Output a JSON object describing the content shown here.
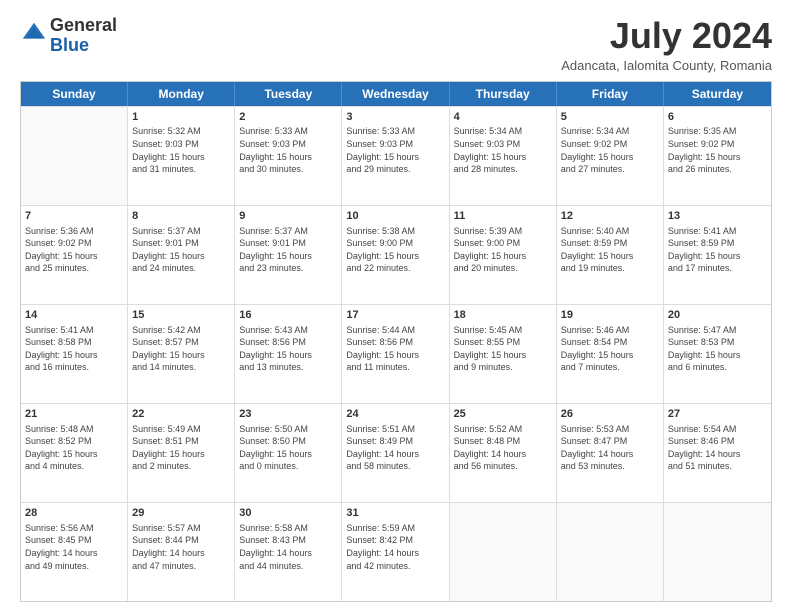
{
  "header": {
    "logo_general": "General",
    "logo_blue": "Blue",
    "month_title": "July 2024",
    "location": "Adancata, Ialomita County, Romania"
  },
  "weekdays": [
    "Sunday",
    "Monday",
    "Tuesday",
    "Wednesday",
    "Thursday",
    "Friday",
    "Saturday"
  ],
  "rows": [
    [
      {
        "day": "",
        "info": ""
      },
      {
        "day": "1",
        "info": "Sunrise: 5:32 AM\nSunset: 9:03 PM\nDaylight: 15 hours\nand 31 minutes."
      },
      {
        "day": "2",
        "info": "Sunrise: 5:33 AM\nSunset: 9:03 PM\nDaylight: 15 hours\nand 30 minutes."
      },
      {
        "day": "3",
        "info": "Sunrise: 5:33 AM\nSunset: 9:03 PM\nDaylight: 15 hours\nand 29 minutes."
      },
      {
        "day": "4",
        "info": "Sunrise: 5:34 AM\nSunset: 9:03 PM\nDaylight: 15 hours\nand 28 minutes."
      },
      {
        "day": "5",
        "info": "Sunrise: 5:34 AM\nSunset: 9:02 PM\nDaylight: 15 hours\nand 27 minutes."
      },
      {
        "day": "6",
        "info": "Sunrise: 5:35 AM\nSunset: 9:02 PM\nDaylight: 15 hours\nand 26 minutes."
      }
    ],
    [
      {
        "day": "7",
        "info": "Sunrise: 5:36 AM\nSunset: 9:02 PM\nDaylight: 15 hours\nand 25 minutes."
      },
      {
        "day": "8",
        "info": "Sunrise: 5:37 AM\nSunset: 9:01 PM\nDaylight: 15 hours\nand 24 minutes."
      },
      {
        "day": "9",
        "info": "Sunrise: 5:37 AM\nSunset: 9:01 PM\nDaylight: 15 hours\nand 23 minutes."
      },
      {
        "day": "10",
        "info": "Sunrise: 5:38 AM\nSunset: 9:00 PM\nDaylight: 15 hours\nand 22 minutes."
      },
      {
        "day": "11",
        "info": "Sunrise: 5:39 AM\nSunset: 9:00 PM\nDaylight: 15 hours\nand 20 minutes."
      },
      {
        "day": "12",
        "info": "Sunrise: 5:40 AM\nSunset: 8:59 PM\nDaylight: 15 hours\nand 19 minutes."
      },
      {
        "day": "13",
        "info": "Sunrise: 5:41 AM\nSunset: 8:59 PM\nDaylight: 15 hours\nand 17 minutes."
      }
    ],
    [
      {
        "day": "14",
        "info": "Sunrise: 5:41 AM\nSunset: 8:58 PM\nDaylight: 15 hours\nand 16 minutes."
      },
      {
        "day": "15",
        "info": "Sunrise: 5:42 AM\nSunset: 8:57 PM\nDaylight: 15 hours\nand 14 minutes."
      },
      {
        "day": "16",
        "info": "Sunrise: 5:43 AM\nSunset: 8:56 PM\nDaylight: 15 hours\nand 13 minutes."
      },
      {
        "day": "17",
        "info": "Sunrise: 5:44 AM\nSunset: 8:56 PM\nDaylight: 15 hours\nand 11 minutes."
      },
      {
        "day": "18",
        "info": "Sunrise: 5:45 AM\nSunset: 8:55 PM\nDaylight: 15 hours\nand 9 minutes."
      },
      {
        "day": "19",
        "info": "Sunrise: 5:46 AM\nSunset: 8:54 PM\nDaylight: 15 hours\nand 7 minutes."
      },
      {
        "day": "20",
        "info": "Sunrise: 5:47 AM\nSunset: 8:53 PM\nDaylight: 15 hours\nand 6 minutes."
      }
    ],
    [
      {
        "day": "21",
        "info": "Sunrise: 5:48 AM\nSunset: 8:52 PM\nDaylight: 15 hours\nand 4 minutes."
      },
      {
        "day": "22",
        "info": "Sunrise: 5:49 AM\nSunset: 8:51 PM\nDaylight: 15 hours\nand 2 minutes."
      },
      {
        "day": "23",
        "info": "Sunrise: 5:50 AM\nSunset: 8:50 PM\nDaylight: 15 hours\nand 0 minutes."
      },
      {
        "day": "24",
        "info": "Sunrise: 5:51 AM\nSunset: 8:49 PM\nDaylight: 14 hours\nand 58 minutes."
      },
      {
        "day": "25",
        "info": "Sunrise: 5:52 AM\nSunset: 8:48 PM\nDaylight: 14 hours\nand 56 minutes."
      },
      {
        "day": "26",
        "info": "Sunrise: 5:53 AM\nSunset: 8:47 PM\nDaylight: 14 hours\nand 53 minutes."
      },
      {
        "day": "27",
        "info": "Sunrise: 5:54 AM\nSunset: 8:46 PM\nDaylight: 14 hours\nand 51 minutes."
      }
    ],
    [
      {
        "day": "28",
        "info": "Sunrise: 5:56 AM\nSunset: 8:45 PM\nDaylight: 14 hours\nand 49 minutes."
      },
      {
        "day": "29",
        "info": "Sunrise: 5:57 AM\nSunset: 8:44 PM\nDaylight: 14 hours\nand 47 minutes."
      },
      {
        "day": "30",
        "info": "Sunrise: 5:58 AM\nSunset: 8:43 PM\nDaylight: 14 hours\nand 44 minutes."
      },
      {
        "day": "31",
        "info": "Sunrise: 5:59 AM\nSunset: 8:42 PM\nDaylight: 14 hours\nand 42 minutes."
      },
      {
        "day": "",
        "info": ""
      },
      {
        "day": "",
        "info": ""
      },
      {
        "day": "",
        "info": ""
      }
    ]
  ]
}
